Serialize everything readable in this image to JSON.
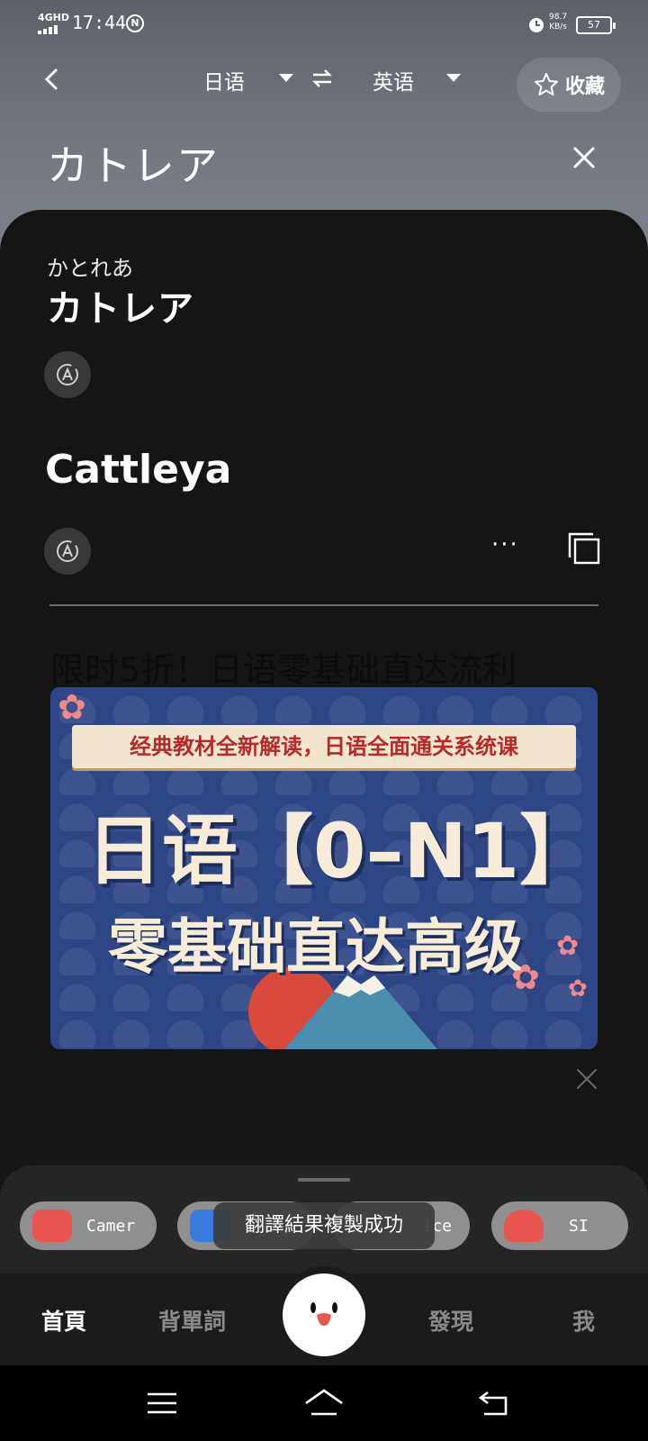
{
  "status_bar": {
    "network": "4GHD",
    "time": "17:44",
    "nfc_label": "N",
    "net_speed": "98.7",
    "net_speed_unit": "KB/s",
    "battery": "57"
  },
  "header": {
    "source_language": "日语",
    "target_language": "英语",
    "favorite_label": "收藏",
    "query": "カトレア"
  },
  "result": {
    "reading": "かとれあ",
    "headword": "カトレア",
    "translation": "Cattleya",
    "more_label": "···"
  },
  "ad": {
    "title": "限时5折！日语零基础直达流利",
    "ribbon": "经典教材全新解读，日语全面通关系统课",
    "headline": "日语【0–N1】",
    "subline": "零基础直达高级"
  },
  "tools": [
    {
      "label": "Camer",
      "icon": "camera-icon",
      "color": "#e8554e"
    },
    {
      "label": "",
      "icon": "document-icon",
      "color": "#3a7be0"
    },
    {
      "label": "ice",
      "icon": "voice-icon",
      "color": "#6b6b6b"
    },
    {
      "label": "SI",
      "icon": "si-icon",
      "color": "#e8554e"
    }
  ],
  "toast": "翻譯結果複製成功",
  "tabs": {
    "home": "首頁",
    "vocab": "背單詞",
    "discover": "發現",
    "me": "我"
  }
}
